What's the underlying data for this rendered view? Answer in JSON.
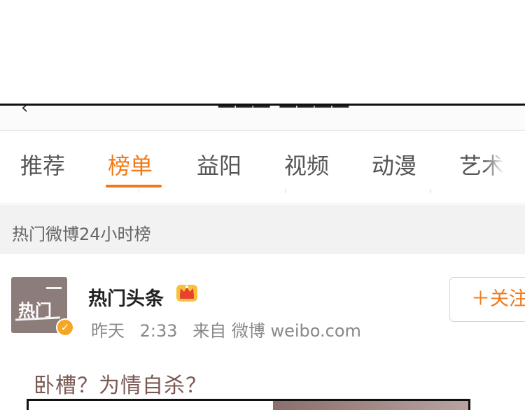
{
  "tabs": [
    {
      "label": "推荐",
      "active": false
    },
    {
      "label": "榜单",
      "active": true
    },
    {
      "label": "益阳",
      "active": false
    },
    {
      "label": "视频",
      "active": false
    },
    {
      "label": "动漫",
      "active": false
    },
    {
      "label": "艺术",
      "active": false
    }
  ],
  "section_header": "热门微博24小时榜",
  "post": {
    "avatar_text": "热门",
    "author": "热门头条",
    "time_day": "昨天",
    "time": "2:33",
    "source": "来自 微博 weibo.com",
    "follow_label": "＋关注",
    "text": "卧槽？为情自杀？",
    "verified_icon": "v-verified-icon",
    "crown_icon": "crown-member-icon"
  },
  "colors": {
    "accent": "#f07a1a",
    "section_bg": "#f2f2f2",
    "verified": "#f5a623",
    "post_text": "#7a5a55"
  }
}
